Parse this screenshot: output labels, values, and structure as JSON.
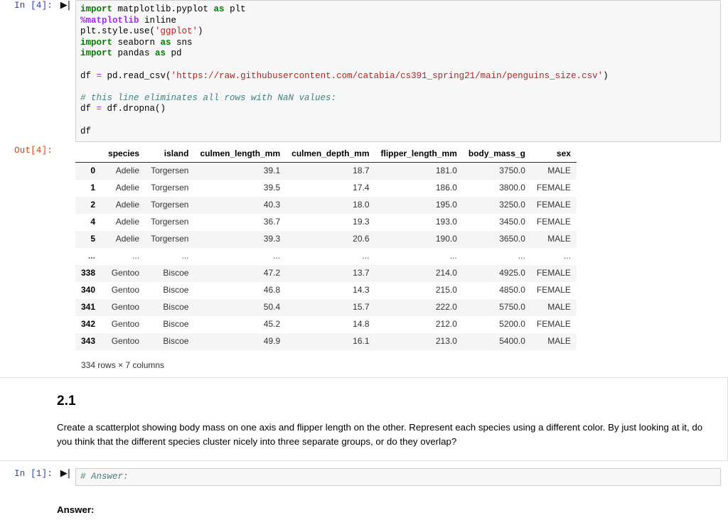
{
  "cells": [
    {
      "prompt": "In [4]:",
      "run_icon": "run-cell-icon",
      "code_lines": [
        "import matplotlib.pyplot as plt",
        "%matplotlib inline",
        "plt.style.use('ggplot')",
        "import seaborn as sns",
        "import pandas as pd",
        "",
        "df = pd.read_csv('https://raw.githubusercontent.com/catabia/cs391_spring21/main/penguins_size.csv')",
        "",
        "# this line eliminates all rows with NaN values:",
        "df = df.dropna()",
        "",
        "df"
      ]
    }
  ],
  "code_cell_1": {
    "prompt": "In [4]:",
    "l1_kw": "import",
    "l1_rest": " matplotlib.pyplot ",
    "l1_as": "as",
    "l1_tail": " plt",
    "l2_magic": "%matplotlib",
    "l2_tail": " inline",
    "l3_head": "plt.style.use(",
    "l3_str": "'ggplot'",
    "l3_tail": ")",
    "l4_kw": "import",
    "l4_mid": " seaborn ",
    "l4_as": "as",
    "l4_tail": " sns",
    "l5_kw": "import",
    "l5_mid": " pandas ",
    "l5_as": "as",
    "l5_tail": " pd",
    "l6_head": "df ",
    "l6_eq": "=",
    "l6_mid": " pd.read_csv(",
    "l6_str": "'https://raw.githubusercontent.com/catabia/cs391_spring21/main/penguins_size.csv'",
    "l6_tail": ")",
    "l7_comment": "# this line eliminates all rows with NaN values:",
    "l8_head": "df ",
    "l8_eq": "=",
    "l8_tail": " df.dropna()",
    "l9": "df"
  },
  "output_cell_1": {
    "prompt": "Out[4]:",
    "table": {
      "index_header": "",
      "columns": [
        "species",
        "island",
        "culmen_length_mm",
        "culmen_depth_mm",
        "flipper_length_mm",
        "body_mass_g",
        "sex"
      ],
      "rows": [
        {
          "index": "0",
          "cells": [
            "Adelie",
            "Torgersen",
            "39.1",
            "18.7",
            "181.0",
            "3750.0",
            "MALE"
          ]
        },
        {
          "index": "1",
          "cells": [
            "Adelie",
            "Torgersen",
            "39.5",
            "17.4",
            "186.0",
            "3800.0",
            "FEMALE"
          ]
        },
        {
          "index": "2",
          "cells": [
            "Adelie",
            "Torgersen",
            "40.3",
            "18.0",
            "195.0",
            "3250.0",
            "FEMALE"
          ]
        },
        {
          "index": "4",
          "cells": [
            "Adelie",
            "Torgersen",
            "36.7",
            "19.3",
            "193.0",
            "3450.0",
            "FEMALE"
          ]
        },
        {
          "index": "5",
          "cells": [
            "Adelie",
            "Torgersen",
            "39.3",
            "20.6",
            "190.0",
            "3650.0",
            "MALE"
          ]
        },
        {
          "index": "...",
          "cells": [
            "...",
            "...",
            "...",
            "...",
            "...",
            "...",
            "..."
          ],
          "ellipsis": true
        },
        {
          "index": "338",
          "cells": [
            "Gentoo",
            "Biscoe",
            "47.2",
            "13.7",
            "214.0",
            "4925.0",
            "FEMALE"
          ]
        },
        {
          "index": "340",
          "cells": [
            "Gentoo",
            "Biscoe",
            "46.8",
            "14.3",
            "215.0",
            "4850.0",
            "FEMALE"
          ]
        },
        {
          "index": "341",
          "cells": [
            "Gentoo",
            "Biscoe",
            "50.4",
            "15.7",
            "222.0",
            "5750.0",
            "MALE"
          ]
        },
        {
          "index": "342",
          "cells": [
            "Gentoo",
            "Biscoe",
            "45.2",
            "14.8",
            "212.0",
            "5200.0",
            "FEMALE"
          ]
        },
        {
          "index": "343",
          "cells": [
            "Gentoo",
            "Biscoe",
            "49.9",
            "16.1",
            "213.0",
            "5400.0",
            "MALE"
          ]
        }
      ]
    },
    "shape": "334 rows × 7 columns"
  },
  "markdown_cell": {
    "heading": "2.1",
    "paragraph": "Create a scatterplot showing body mass on one axis and flipper length on the other. Represent each species using a different color. By just looking at it, do you think that the different species cluster nicely into three separate groups, or do they overlap?"
  },
  "code_cell_2": {
    "prompt": "In [1]:",
    "comment": "# Answer:"
  },
  "answer_block": {
    "label": "Answer:"
  },
  "icons": {
    "run_cell": "▶|"
  },
  "colors": {
    "prompt_in": "#303f9f",
    "prompt_out": "#d84315",
    "keyword": "#008000",
    "string": "#ba2121",
    "comment": "#408080",
    "operator": "#aa22ff",
    "code_bg": "#f7f7f7",
    "code_border": "#cfcfcf",
    "row_stripe": "#f5f5f5",
    "cell_border": "#e0e0e0"
  }
}
